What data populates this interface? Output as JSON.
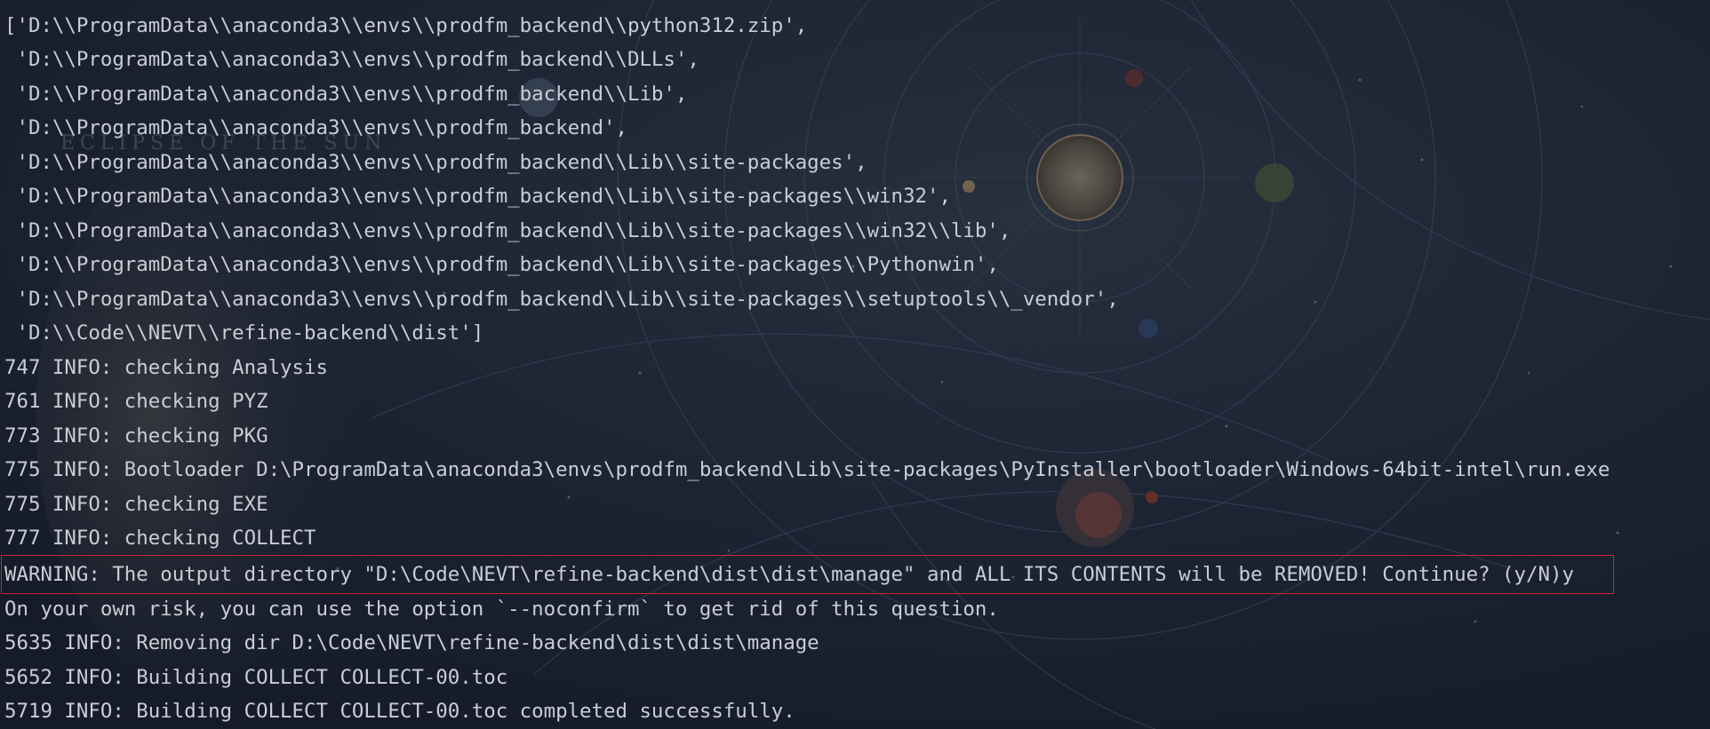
{
  "terminal": {
    "lines": [
      "['D:\\\\ProgramData\\\\anaconda3\\\\envs\\\\prodfm_backend\\\\python312.zip',",
      " 'D:\\\\ProgramData\\\\anaconda3\\\\envs\\\\prodfm_backend\\\\DLLs',",
      " 'D:\\\\ProgramData\\\\anaconda3\\\\envs\\\\prodfm_backend\\\\Lib',",
      " 'D:\\\\ProgramData\\\\anaconda3\\\\envs\\\\prodfm_backend',",
      " 'D:\\\\ProgramData\\\\anaconda3\\\\envs\\\\prodfm_backend\\\\Lib\\\\site-packages',",
      " 'D:\\\\ProgramData\\\\anaconda3\\\\envs\\\\prodfm_backend\\\\Lib\\\\site-packages\\\\win32',",
      " 'D:\\\\ProgramData\\\\anaconda3\\\\envs\\\\prodfm_backend\\\\Lib\\\\site-packages\\\\win32\\\\lib',",
      " 'D:\\\\ProgramData\\\\anaconda3\\\\envs\\\\prodfm_backend\\\\Lib\\\\site-packages\\\\Pythonwin',",
      " 'D:\\\\ProgramData\\\\anaconda3\\\\envs\\\\prodfm_backend\\\\Lib\\\\site-packages\\\\setuptools\\\\_vendor',",
      " 'D:\\\\Code\\\\NEVT\\\\refine-backend\\\\dist']",
      "747 INFO: checking Analysis",
      "761 INFO: checking PYZ",
      "773 INFO: checking PKG",
      "775 INFO: Bootloader D:\\ProgramData\\anaconda3\\envs\\prodfm_backend\\Lib\\site-packages\\PyInstaller\\bootloader\\Windows-64bit-intel\\run.exe",
      "775 INFO: checking EXE",
      "777 INFO: checking COLLECT",
      "WARNING: The output directory \"D:\\Code\\NEVT\\refine-backend\\dist\\dist\\manage\" and ALL ITS CONTENTS will be REMOVED! Continue? (y/N)y",
      "On your own risk, you can use the option `--noconfirm` to get rid of this question.",
      "5635 INFO: Removing dir D:\\Code\\NEVT\\refine-backend\\dist\\dist\\manage",
      "5652 INFO: Building COLLECT COLLECT-00.toc",
      "5719 INFO: Building COLLECT COLLECT-00.toc completed successfully."
    ]
  },
  "background": {
    "text": "ECLIPSE OF THE SUN"
  },
  "colors": {
    "background": "#1a2130",
    "text": "#c9cdd6",
    "highlight_border": "#d0232b"
  }
}
